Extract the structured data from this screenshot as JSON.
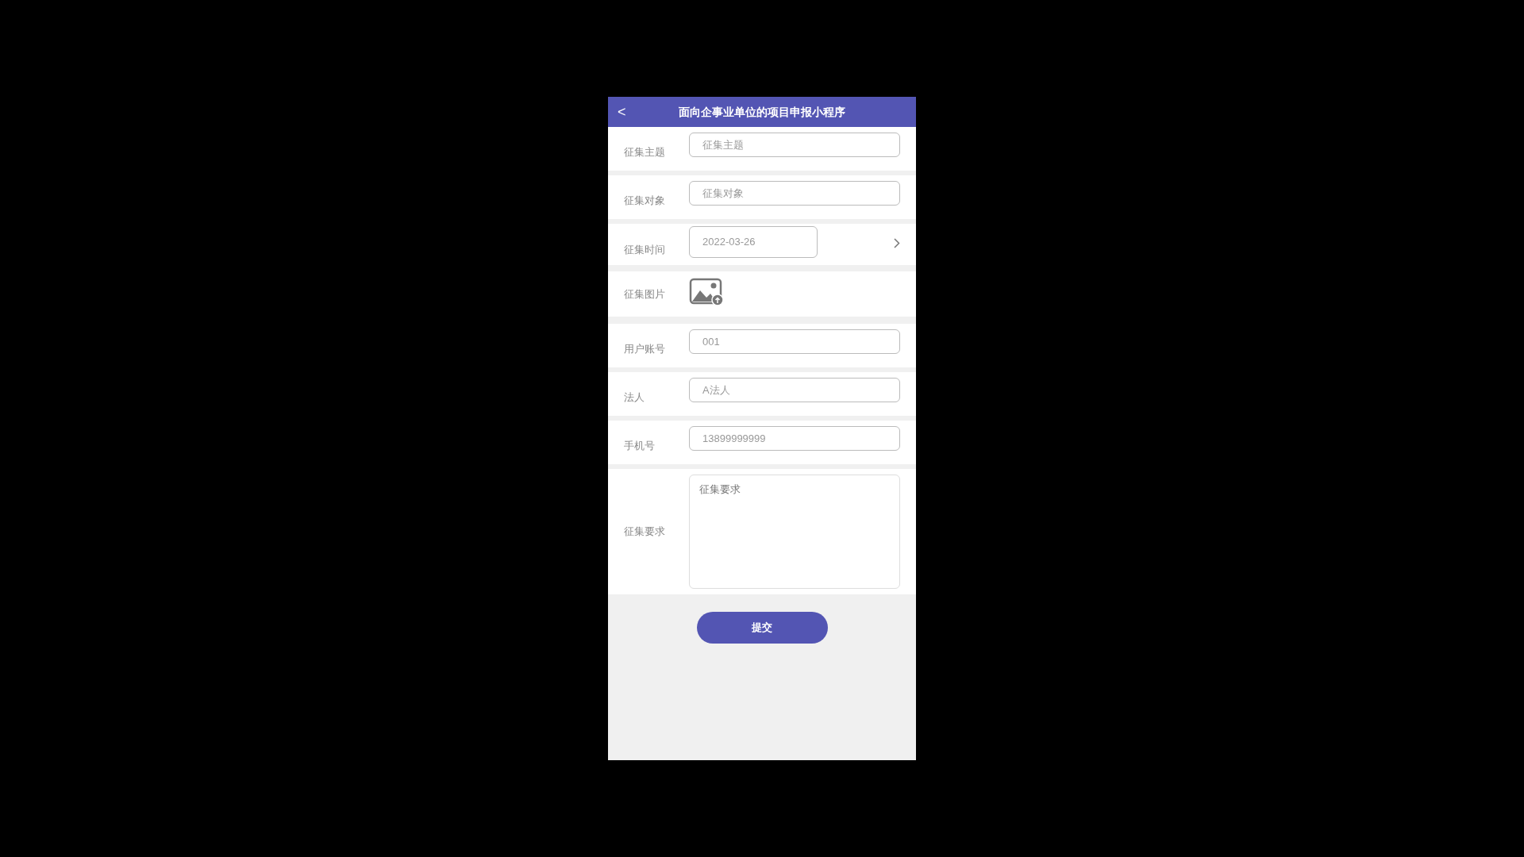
{
  "header": {
    "back": "<",
    "title": "面向企事业单位的项目申报小程序"
  },
  "fields": [
    {
      "kind": "input",
      "label": "征集主题",
      "placeholder": "征集主题"
    },
    {
      "kind": "input",
      "label": "征集对象",
      "placeholder": "征集对象"
    },
    {
      "kind": "date",
      "label": "征集时间",
      "value": "2022-03-26"
    },
    {
      "kind": "image",
      "label": "征集图片"
    },
    {
      "kind": "input",
      "label": "用户账号",
      "placeholder": "001"
    },
    {
      "kind": "input",
      "label": "法人",
      "placeholder": "A法人"
    },
    {
      "kind": "input",
      "label": "手机号",
      "placeholder": "13899999999"
    },
    {
      "kind": "textarea",
      "label": "征集要求",
      "placeholder": "征集要求"
    }
  ],
  "submit": "提交"
}
